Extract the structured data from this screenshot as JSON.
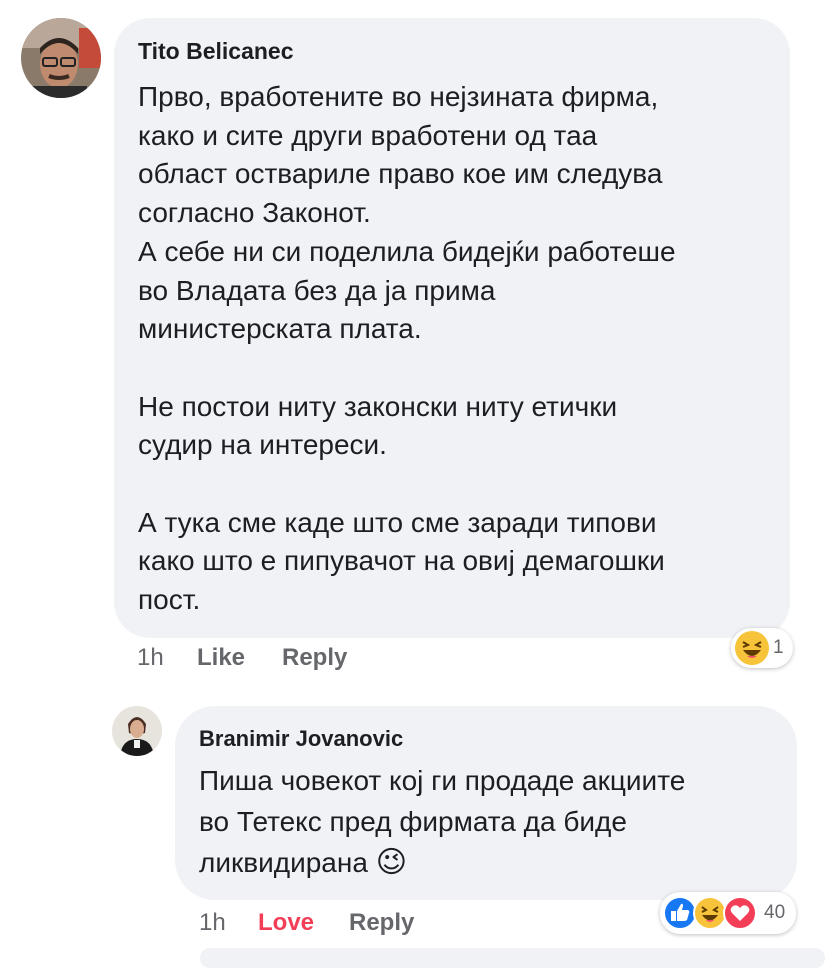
{
  "comments": [
    {
      "author": "Tito Belicanec",
      "text": "Прво, вработените во нејзината фирма,\nкако и сите други вработени од таа\nобласт оствариле право кое им следува\nсогласно Законот.\nА себе ни си поделила бидејќи работеше\nво Владата без да ја прима\nминистерската плата.\n\nНе постои ниту законски ниту етички\nсудир на интереси.\n\nА тука сме каде што сме заради типови\nкако што е пипувачот на овиј демагошки\nпост.",
      "time": "1h",
      "like_label": "Like",
      "reply_label": "Reply",
      "reactions": {
        "icons": [
          "haha-icon"
        ],
        "count": "1"
      }
    },
    {
      "author": "Branimir Jovanovic",
      "text": "Пиша човекот кој ги продаде акциите\nво Тетекс пред фирмата да биде\nликвидирана",
      "emoji": "😉",
      "time": "1h",
      "react_label": "Love",
      "reply_label": "Reply",
      "reactions": {
        "icons": [
          "like-icon",
          "haha-icon",
          "love-icon"
        ],
        "count": "40"
      }
    }
  ],
  "colors": {
    "bubble": "#f0f2f5",
    "love": "#f33e58",
    "like": "#1877f2",
    "meta": "#65676b"
  }
}
